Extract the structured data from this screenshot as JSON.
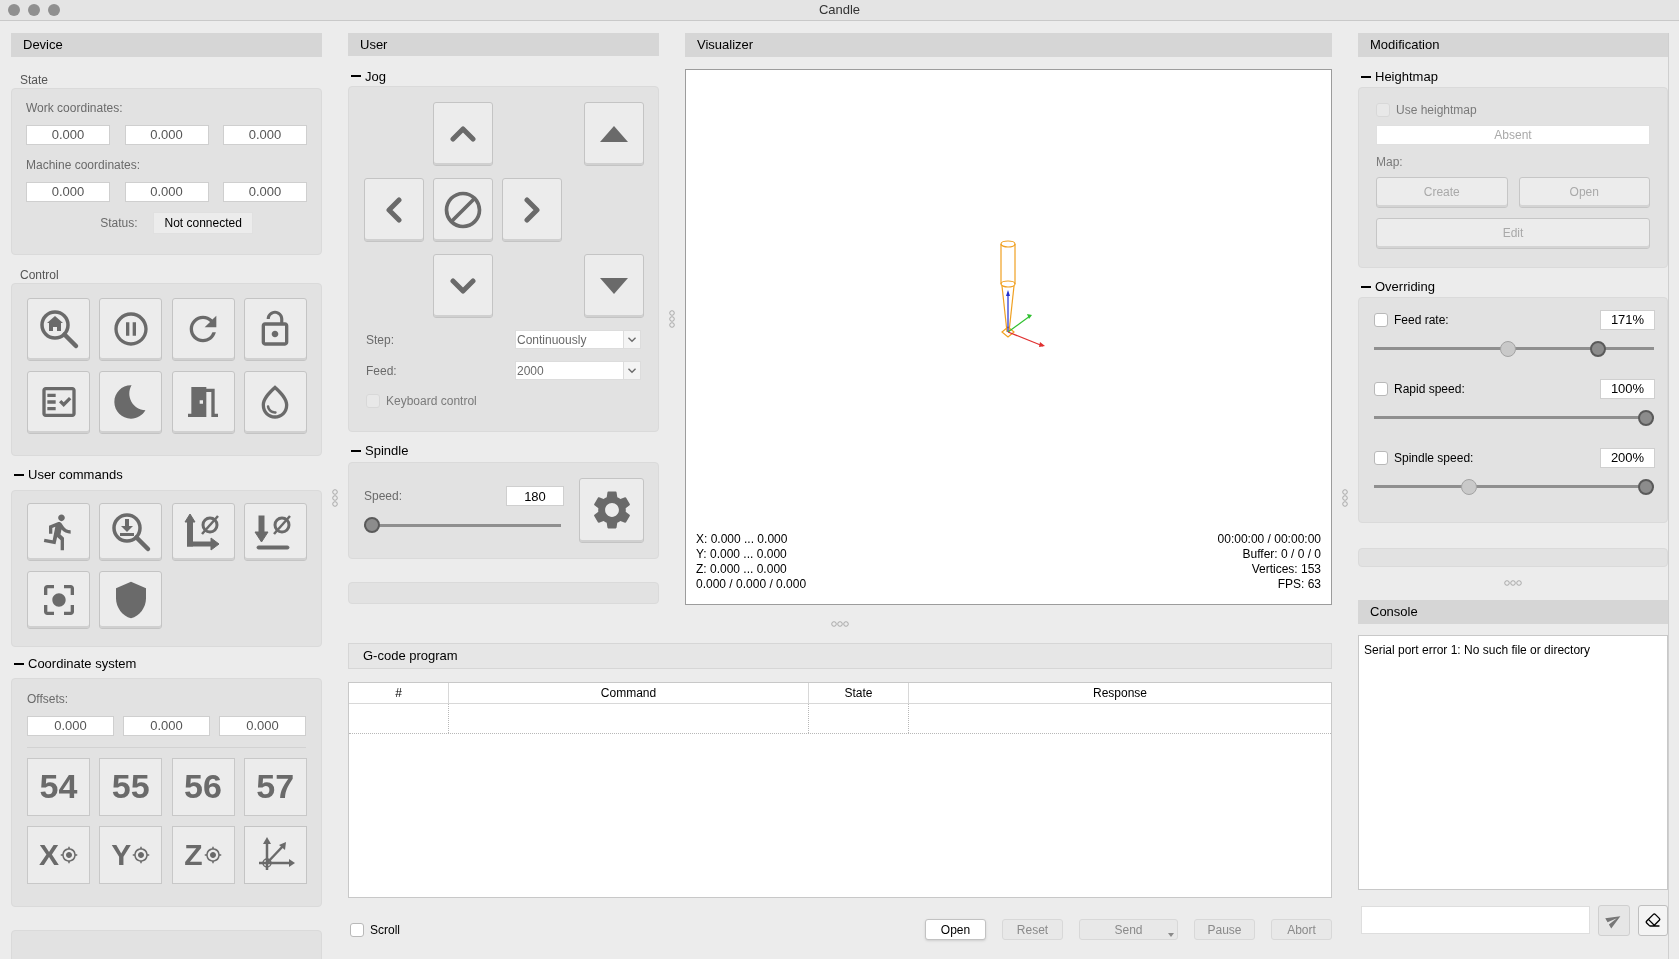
{
  "window": {
    "title": "Candle"
  },
  "device": {
    "title": "Device",
    "state": {
      "label": "State",
      "work_label": "Work coordinates:",
      "work": [
        "0.000",
        "0.000",
        "0.000"
      ],
      "machine_label": "Machine coordinates:",
      "machine": [
        "0.000",
        "0.000",
        "0.000"
      ],
      "status_label": "Status:",
      "status": "Not connected"
    },
    "control": {
      "label": "Control"
    },
    "user_commands": {
      "label": "User commands"
    },
    "coordinate_system": {
      "label": "Coordinate system",
      "offsets_label": "Offsets:",
      "offsets": [
        "0.000",
        "0.000",
        "0.000"
      ],
      "systems": [
        "54",
        "55",
        "56",
        "57"
      ],
      "zero_axes": [
        "X",
        "Y",
        "Z"
      ]
    }
  },
  "user": {
    "title": "User",
    "jog": {
      "label": "Jog",
      "step_label": "Step:",
      "step": "Continuously",
      "feed_label": "Feed:",
      "feed": "2000",
      "keyboard": {
        "label": "Keyboard control",
        "checked": false,
        "disabled": true
      }
    },
    "spindle": {
      "label": "Spindle",
      "speed_label": "Speed:",
      "speed": "180",
      "level": 0.0
    }
  },
  "visualizer": {
    "title": "Visualizer",
    "info_left": [
      "X: 0.000 ... 0.000",
      "Y: 0.000 ... 0.000",
      "Z: 0.000 ... 0.000",
      "0.000 / 0.000 / 0.000"
    ],
    "info_right": [
      "00:00:00 / 00:00:00",
      "Buffer: 0 / 0 / 0",
      "Vertices: 153",
      "FPS: 63"
    ]
  },
  "gcode": {
    "title": "G-code program",
    "columns": [
      "#",
      "Command",
      "State",
      "Response"
    ],
    "scroll": {
      "label": "Scroll",
      "checked": false
    },
    "buttons": [
      {
        "label": "Open",
        "kind": "push",
        "disabled": false
      },
      {
        "label": "Reset",
        "kind": "push",
        "disabled": true
      },
      {
        "label": "Send",
        "kind": "menu",
        "disabled": true
      },
      {
        "label": "Pause",
        "kind": "push",
        "disabled": true
      },
      {
        "label": "Abort",
        "kind": "push",
        "disabled": true
      }
    ]
  },
  "modification": {
    "title": "Modification",
    "heightmap": {
      "label": "Heightmap",
      "use": {
        "label": "Use heightmap",
        "checked": false,
        "disabled": true
      },
      "file": "Absent",
      "map_label": "Map:",
      "buttons": [
        {
          "label": "Create",
          "disabled": true
        },
        {
          "label": "Open",
          "disabled": true
        },
        {
          "label": "Edit",
          "disabled": true
        }
      ]
    },
    "overriding": {
      "label": "Overriding",
      "items": [
        {
          "label": "Feed rate:",
          "checked": false,
          "value": "171%",
          "level": 0.83,
          "default": {
            "level": 0.48
          }
        },
        {
          "label": "Rapid speed:",
          "checked": false,
          "value": "100%",
          "level": 1.0
        },
        {
          "label": "Spindle speed:",
          "checked": false,
          "value": "200%",
          "level": 1.0,
          "default": {
            "level": 0.34
          }
        }
      ]
    }
  },
  "console": {
    "title": "Console",
    "lines": [
      "Serial port error 1: No such file or directory"
    ]
  }
}
